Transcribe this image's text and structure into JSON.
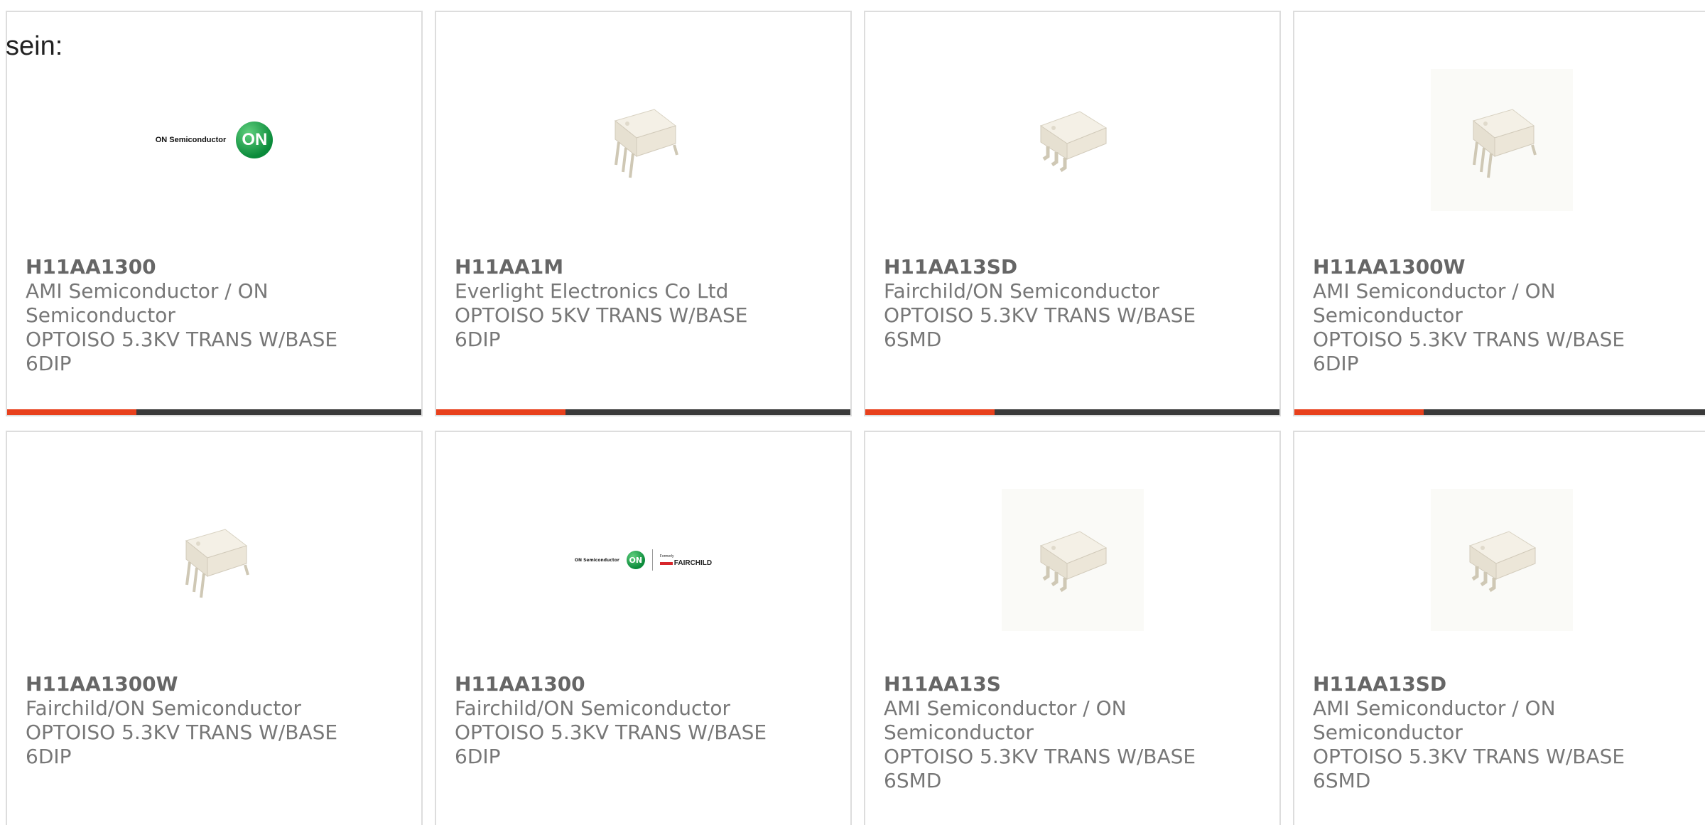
{
  "heading_fragment": "sein:",
  "products": [
    {
      "part_number": "H11AA1300",
      "manufacturer": "AMI Semiconductor / ON Semiconductor",
      "description": "OPTOISO 5.3KV TRANS W/BASE 6DIP",
      "image": "on-semiconductor-logo"
    },
    {
      "part_number": "H11AA1M",
      "manufacturer": "Everlight Electronics Co Ltd",
      "description": "OPTOISO 5KV TRANS W/BASE 6DIP",
      "image": "dip6-chip-icon"
    },
    {
      "part_number": "H11AA13SD",
      "manufacturer": "Fairchild/ON Semiconductor",
      "description": "OPTOISO 5.3KV TRANS W/BASE 6SMD",
      "image": "smd6-chip-icon"
    },
    {
      "part_number": "H11AA1300W",
      "manufacturer": "AMI Semiconductor / ON Semiconductor",
      "description": "OPTOISO 5.3KV TRANS W/BASE 6DIP",
      "image": "dip6-chip-icon"
    },
    {
      "part_number": "H11AA1300W",
      "manufacturer": "Fairchild/ON Semiconductor",
      "description": "OPTOISO 5.3KV TRANS W/BASE 6DIP",
      "image": "dip6-chip-icon"
    },
    {
      "part_number": "H11AA1300",
      "manufacturer": "Fairchild/ON Semiconductor",
      "description": "OPTOISO 5.3KV TRANS W/BASE 6DIP",
      "image": "on-fairchild-logo"
    },
    {
      "part_number": "H11AA13S",
      "manufacturer": "AMI Semiconductor / ON Semiconductor",
      "description": "OPTOISO 5.3KV TRANS W/BASE 6SMD",
      "image": "smd6-chip-icon"
    },
    {
      "part_number": "H11AA13SD",
      "manufacturer": "AMI Semiconductor / ON Semiconductor",
      "description": "OPTOISO 5.3KV TRANS W/BASE 6SMD",
      "image": "smd6-chip-icon"
    }
  ],
  "logos": {
    "on_semiconductor": "ON Semiconductor",
    "on_mark": "ON",
    "formerly": "Formerly",
    "fairchild": "FAIRCHILD"
  },
  "colors": {
    "accent": "#e8401c",
    "bar": "#3a3a3a",
    "border": "#dddddd",
    "chip_body": "#efe9dc"
  }
}
